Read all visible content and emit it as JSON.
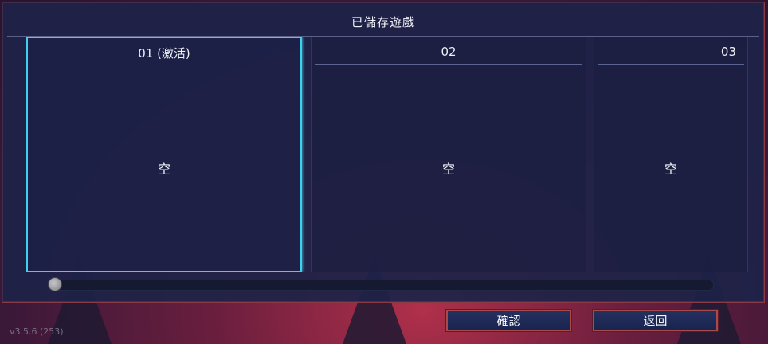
{
  "panel": {
    "title": "已儲存遊戲"
  },
  "slots": [
    {
      "label": "01 (激活)",
      "content": "空",
      "active": true
    },
    {
      "label": "02",
      "content": "空",
      "active": false
    },
    {
      "label": "03",
      "content": "空",
      "active": false
    }
  ],
  "scroll": {
    "position": 0
  },
  "buttons": {
    "confirm": "確認",
    "back": "返回"
  },
  "version": "v3.5.6 (253)",
  "colors": {
    "active_border": "#3fd0ee",
    "panel_bg": "#1e2248",
    "button_border": "#a84a4a"
  }
}
